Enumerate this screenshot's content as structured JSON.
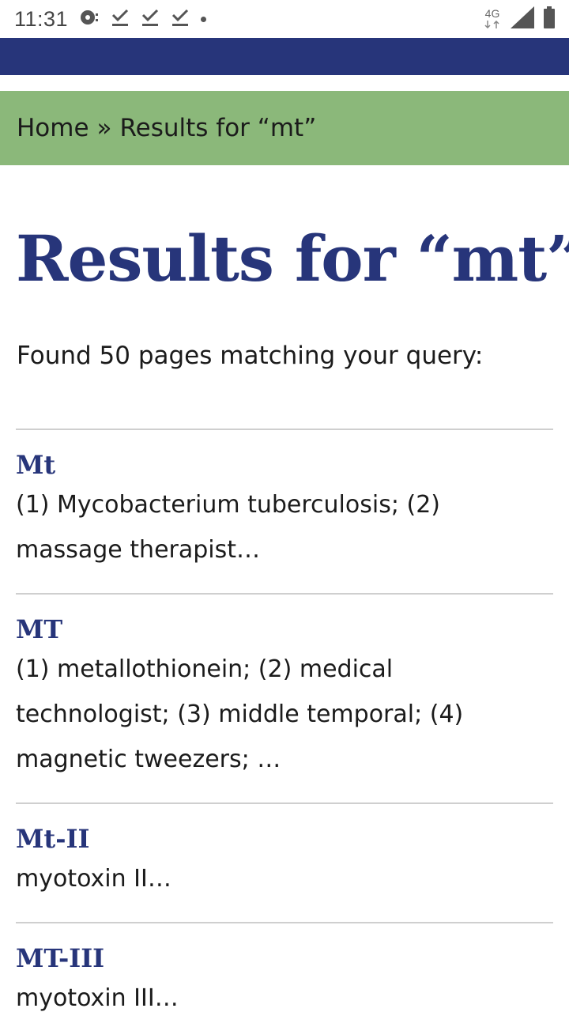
{
  "status_bar": {
    "time": "11:31",
    "network": "4G",
    "icons": [
      "hotspot-icon",
      "download-done-icon",
      "download-done-icon",
      "download-done-icon",
      "notification-dot-icon",
      "signal-icon",
      "battery-icon"
    ]
  },
  "colors": {
    "nav": "#27357a",
    "breadcrumb_bg": "#8bb87a",
    "title": "#27357a"
  },
  "breadcrumb": {
    "home": "Home",
    "separator": "»",
    "current": "Results for “mt”"
  },
  "page_title": "Results for “mt”",
  "result_count": "Found 50 pages matching your query:",
  "results": [
    {
      "title": "Mt",
      "snippet": "(1) Mycobacterium tuberculosis; (2) massage therapist…"
    },
    {
      "title": "MT",
      "snippet": "(1) metallothionein; (2) medical technologist; (3) middle temporal; (4) magnetic tweezers; …"
    },
    {
      "title": "Mt-II",
      "snippet": "myotoxin II…"
    },
    {
      "title": "MT-III",
      "snippet": "myotoxin III…"
    }
  ]
}
